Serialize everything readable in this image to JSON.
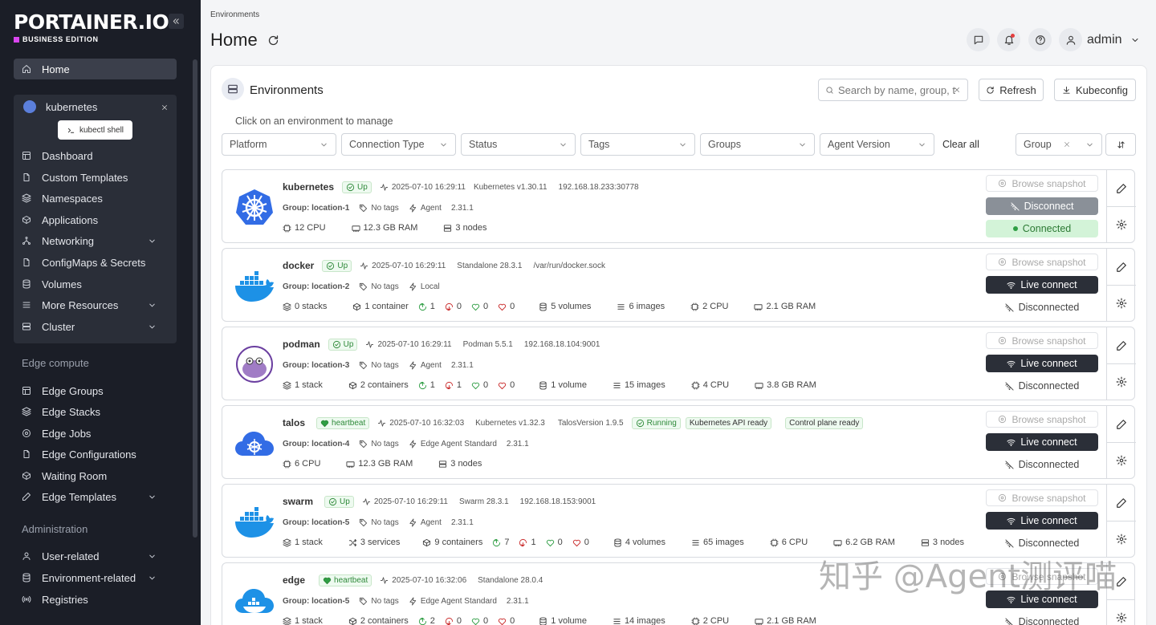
{
  "sidebar": {
    "logo_text": "PORTAINER.IO",
    "logo_sub": "BUSINESS EDITION",
    "home": "Home",
    "env_name": "kubernetes",
    "kubectl_shell": "kubectl shell",
    "env_items": [
      "Dashboard",
      "Custom Templates",
      "Namespaces",
      "Applications",
      "Networking",
      "ConfigMaps & Secrets",
      "Volumes",
      "More Resources",
      "Cluster"
    ],
    "edge_label": "Edge compute",
    "edge_items": [
      "Edge Groups",
      "Edge Stacks",
      "Edge Jobs",
      "Edge Configurations",
      "Waiting Room",
      "Edge Templates"
    ],
    "admin_label": "Administration",
    "admin_items": [
      "User-related",
      "Environment-related",
      "Registries"
    ]
  },
  "header": {
    "breadcrumb": "Environments",
    "title": "Home",
    "user": "admin"
  },
  "panel": {
    "title": "Environments",
    "search_placeholder": "Search by name, group, t",
    "refresh": "Refresh",
    "kubeconfig": "Kubeconfig",
    "hint": "Click on an environment to manage",
    "filters": [
      "Platform",
      "Connection Type",
      "Status",
      "Tags",
      "Groups",
      "Agent Version"
    ],
    "clear_all": "Clear all",
    "group_sort": "Group"
  },
  "labels": {
    "browse_snapshot": "Browse snapshot",
    "live_connect": "Live connect",
    "disconnected": "Disconnected",
    "disconnect": "Disconnect",
    "connected": "Connected",
    "no_tags": "No tags"
  },
  "envs": [
    {
      "name": "kubernetes",
      "status": "Up",
      "time": "2025-07-10 16:29:11",
      "version": "Kubernetes v1.30.11",
      "address": "192.168.18.233:30778",
      "group": "Group: location-1",
      "agent": "Agent",
      "agent_version": "2.31.1",
      "cpu": "12 CPU",
      "ram": "12.3 GB RAM",
      "nodes": "3 nodes"
    },
    {
      "name": "docker",
      "status": "Up",
      "time": "2025-07-10 16:29:11",
      "version": "Standalone 28.3.1",
      "address": "/var/run/docker.sock",
      "group": "Group: location-2",
      "agent": "Local",
      "stacks": "0 stacks",
      "containers": "1 container",
      "running": "1",
      "stopped": "0",
      "healthy": "0",
      "unhealthy": "0",
      "volumes": "5 volumes",
      "images": "6 images",
      "cpu": "2 CPU",
      "ram": "2.1 GB RAM"
    },
    {
      "name": "podman",
      "status": "Up",
      "time": "2025-07-10 16:29:11",
      "version": "Podman 5.5.1",
      "address": "192.168.18.104:9001",
      "group": "Group: location-3",
      "agent": "Agent",
      "agent_version": "2.31.1",
      "stacks": "1 stack",
      "containers": "2 containers",
      "running": "1",
      "stopped": "1",
      "healthy": "0",
      "unhealthy": "0",
      "volumes": "1 volume",
      "images": "15 images",
      "cpu": "4 CPU",
      "ram": "3.8 GB RAM"
    },
    {
      "name": "talos",
      "status": "heartbeat",
      "time": "2025-07-10 16:32:03",
      "version": "Kubernetes v1.32.3",
      "talos": "TalosVersion 1.9.5",
      "running_badge": "Running",
      "api_ready": "Kubernetes API ready",
      "cp_ready": "Control plane ready",
      "group": "Group: location-4",
      "agent": "Edge Agent Standard",
      "agent_version": "2.31.1",
      "cpu": "6 CPU",
      "ram": "12.3 GB RAM",
      "nodes": "3 nodes"
    },
    {
      "name": "swarm",
      "status": "Up",
      "time": "2025-07-10 16:29:11",
      "version": "Swarm 28.3.1",
      "address": "192.168.18.153:9001",
      "group": "Group: location-5",
      "agent": "Agent",
      "agent_version": "2.31.1",
      "stacks": "1 stack",
      "services": "3 services",
      "containers": "9 containers",
      "running": "7",
      "stopped": "1",
      "healthy": "0",
      "unhealthy": "0",
      "volumes": "4 volumes",
      "images": "65 images",
      "cpu": "6 CPU",
      "ram": "6.2 GB RAM",
      "nodes": "3 nodes"
    },
    {
      "name": "edge",
      "status": "heartbeat",
      "time": "2025-07-10 16:32:06",
      "version": "Standalone 28.0.4",
      "group": "Group: location-5",
      "agent": "Edge Agent Standard",
      "agent_version": "2.31.1",
      "stacks": "1 stack",
      "containers": "2 containers",
      "running": "2",
      "stopped": "0",
      "healthy": "0",
      "unhealthy": "0",
      "volumes": "1 volume",
      "images": "14 images",
      "cpu": "2 CPU",
      "ram": "2.1 GB RAM"
    }
  ],
  "watermark": "知乎 @Agent测评喵"
}
